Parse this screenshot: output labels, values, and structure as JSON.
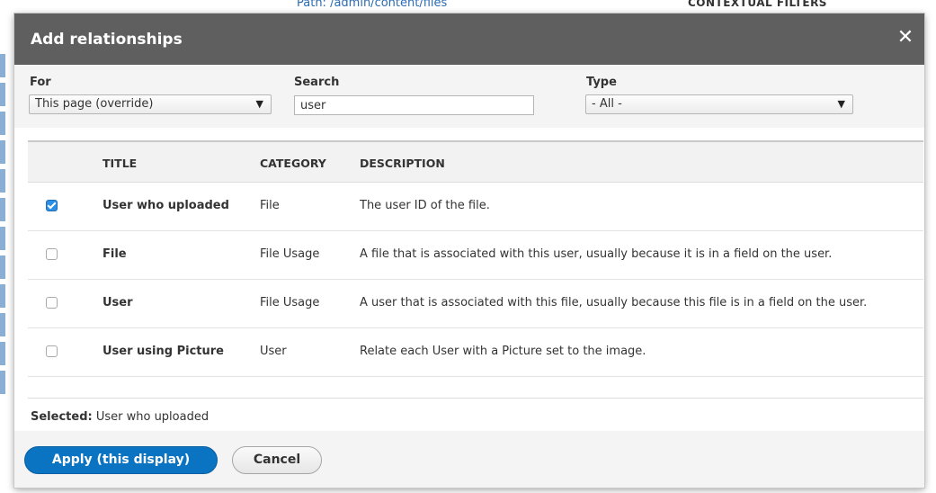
{
  "background": {
    "path_text": "Path: /admin/content/files",
    "contextual_filters": "CONTEXTUAL FILTERS"
  },
  "modal": {
    "title": "Add relationships",
    "close_icon": "close-icon"
  },
  "filters": {
    "for_label": "For",
    "for_value": "This page (override)",
    "search_label": "Search",
    "search_value": "user",
    "type_label": "Type",
    "type_value": "- All -"
  },
  "table": {
    "headers": [
      "TITLE",
      "CATEGORY",
      "DESCRIPTION"
    ],
    "rows": [
      {
        "checked": true,
        "title": "User who uploaded",
        "category": "File",
        "description": "The user ID of the file."
      },
      {
        "checked": false,
        "title": "File",
        "category": "File Usage",
        "description": "A file that is associated with this user, usually because it is in a field on the user."
      },
      {
        "checked": false,
        "title": "User",
        "category": "File Usage",
        "description": "A user that is associated with this file, usually because this file is in a field on the user."
      },
      {
        "checked": false,
        "title": "User using Picture",
        "category": "User",
        "description": "Relate each User with a Picture set to the image."
      }
    ]
  },
  "selected": {
    "label": "Selected:",
    "value": "User who uploaded"
  },
  "footer": {
    "apply_label": "Apply (this display)",
    "cancel_label": "Cancel"
  },
  "colors": {
    "titlebar": "#5f5f5f",
    "primary_button": "#0a73c2",
    "checkbox_checked": "#2d8ee6"
  }
}
